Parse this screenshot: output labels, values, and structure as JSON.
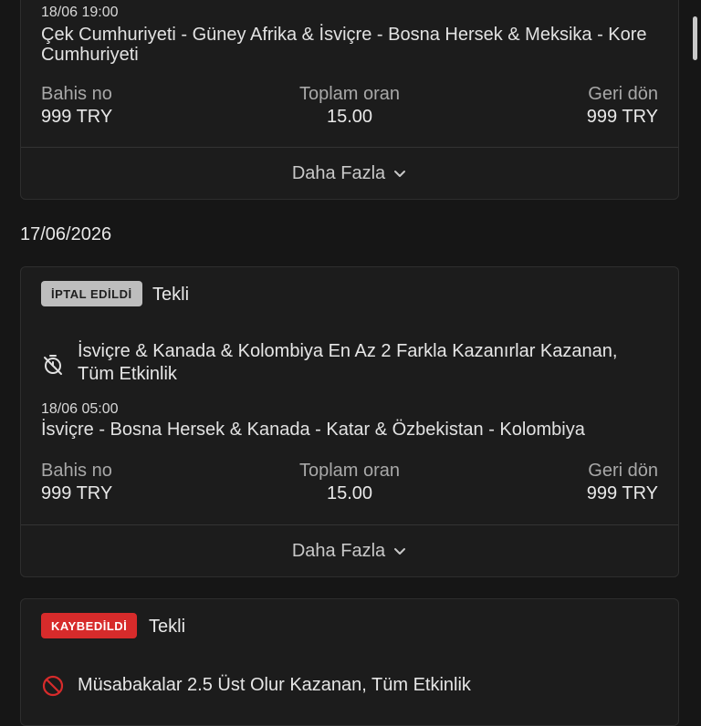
{
  "card1": {
    "time": "18/06 19:00",
    "teams": "Çek Cumhuriyeti - Güney Afrika & İsviçre - Bosna Hersek & Meksika - Kore Cumhuriyeti",
    "stats": {
      "stake_label": "Bahis no",
      "stake_value": "999 TRY",
      "odds_label": "Toplam oran",
      "odds_value": "15.00",
      "return_label": "Geri dön",
      "return_value": "999 TRY"
    },
    "more_label": "Daha Fazla"
  },
  "date_heading": "17/06/2026",
  "card2": {
    "status": "İPTAL EDİLDİ",
    "bet_type": "Tekli",
    "selection": "İsviçre & Kanada & Kolombiya En Az 2 Farkla Kazanırlar Kazanan, Tüm Etkinlik",
    "time": "18/06 05:00",
    "teams": "İsviçre - Bosna Hersek & Kanada - Katar & Özbekistan - Kolombiya",
    "stats": {
      "stake_label": "Bahis no",
      "stake_value": "999 TRY",
      "odds_label": "Toplam oran",
      "odds_value": "15.00",
      "return_label": "Geri dön",
      "return_value": "999 TRY"
    },
    "more_label": "Daha Fazla"
  },
  "card3": {
    "status": "KAYBEDİLDİ",
    "bet_type": "Tekli",
    "selection": "Müsabakalar 2.5 Üst Olur Kazanan, Tüm Etkinlik"
  },
  "icons": {
    "chevron": "chevron-down-icon",
    "stopwatch": "stopwatch-off-icon",
    "lost": "no-entry-icon"
  },
  "colors": {
    "background": "#161616",
    "card": "#1c1c1c",
    "badge_cancel": "#bdbdbd",
    "badge_lost": "#d72b2b"
  }
}
